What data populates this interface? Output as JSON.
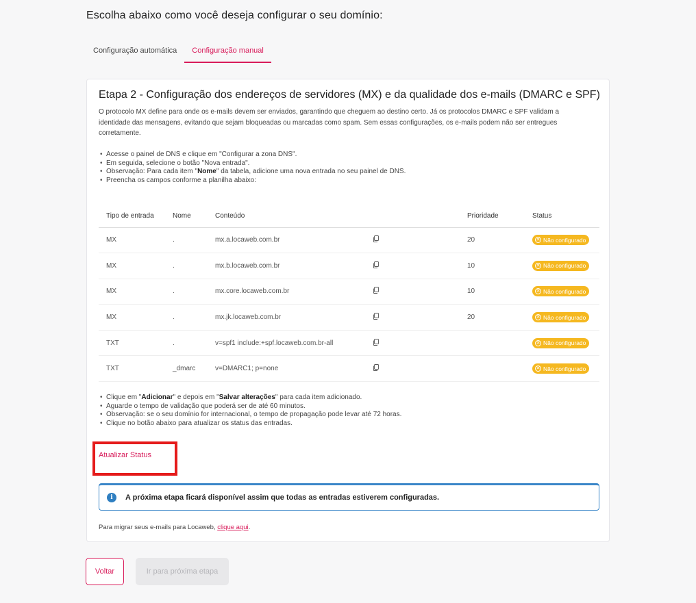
{
  "heading": "Escolha abaixo como você deseja configurar o seu domínio:",
  "tabs": [
    {
      "label": "Configuração automática",
      "active": false
    },
    {
      "label": "Configuração manual",
      "active": true
    }
  ],
  "card": {
    "title": "Etapa 2 - Configuração dos endereços de servidores (MX) e da qualidade dos e-mails (DMARC e SPF)",
    "description": "O protocolo MX define para onde os e-mails devem ser enviados, garantindo que cheguem ao destino certo. Já os protocolos DMARC e SPF validam a identidade das mensagens, evitando que sejam bloqueadas ou marcadas como spam. Sem essas configurações, os e-mails podem não ser entregues corretamente.",
    "instructions": {
      "item1": "Acesse o painel de DNS e clique em \"Configurar a zona DNS\".",
      "item2": "Em seguida, selecione o botão \"Nova entrada\".",
      "item3_prefix": "Observação: Para cada item \"",
      "item3_bold": "Nome",
      "item3_suffix": "\" da tabela, adicione uma nova entrada no seu painel de DNS.",
      "item4": "Preencha os campos conforme a planilha abaixo:"
    },
    "table": {
      "headers": {
        "type": "Tipo de entrada",
        "name": "Nome",
        "content": "Conteúdo",
        "priority": "Prioridade",
        "status": "Status"
      },
      "rows": [
        {
          "type": "MX",
          "name": ".",
          "content": "mx.a.locaweb.com.br",
          "priority": "20",
          "status": "Não configurado"
        },
        {
          "type": "MX",
          "name": ".",
          "content": "mx.b.locaweb.com.br",
          "priority": "10",
          "status": "Não configurado"
        },
        {
          "type": "MX",
          "name": ".",
          "content": "mx.core.locaweb.com.br",
          "priority": "10",
          "status": "Não configurado"
        },
        {
          "type": "MX",
          "name": ".",
          "content": "mx.jk.locaweb.com.br",
          "priority": "20",
          "status": "Não configurado"
        },
        {
          "type": "TXT",
          "name": ".",
          "content": "v=spf1 include:+spf.locaweb.com.br-all",
          "priority": "",
          "status": "Não configurado"
        },
        {
          "type": "TXT",
          "name": "_dmarc",
          "content": "v=DMARC1; p=none",
          "priority": "",
          "status": "Não configurado"
        }
      ]
    },
    "after": {
      "item1_a": "Clique em \"",
      "item1_b": "Adicionar",
      "item1_c": "\" e depois em \"",
      "item1_d": "Salvar alterações",
      "item1_e": "\" para cada item adicionado.",
      "item2": "Aguarde o tempo de validação que poderá ser de até 60 minutos.",
      "item3": "Observação: se o seu domínio for internacional, o tempo de propagação pode levar até 72 horas.",
      "item4": "Clique no botão abaixo para atualizar os status das entradas."
    },
    "update_button": "Atualizar Status",
    "info_text": "A próxima etapa ficará disponível assim que todas as entradas estiverem configuradas.",
    "migrate_prefix": "Para migrar seus e-mails para Locaweb, ",
    "migrate_link": "clique aqui",
    "migrate_suffix": "."
  },
  "footer": {
    "back_label": "Voltar",
    "next_label": "Ir para próxima etapa"
  },
  "colors": {
    "accent": "#d81b5a",
    "badge": "#f5b820",
    "info": "#2f7fc1",
    "highlight": "#e51b1b"
  }
}
